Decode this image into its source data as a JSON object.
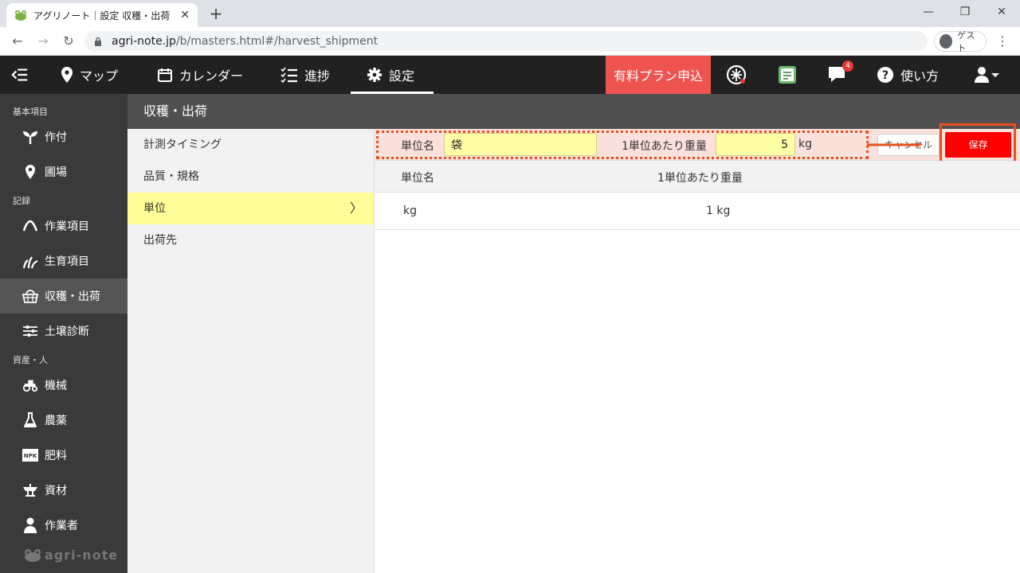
{
  "browser": {
    "tab_title": "アグリノート｜設定 収穫・出荷",
    "url_host": "agri-note.jp",
    "url_path": "/b/masters.html#/harvest_shipment",
    "profile_name": "ゲスト"
  },
  "header": {
    "nav": [
      {
        "label": "マップ",
        "icon": "map-pin-icon"
      },
      {
        "label": "カレンダー",
        "icon": "calendar-icon"
      },
      {
        "label": "進捗",
        "icon": "checklist-icon"
      },
      {
        "label": "設定",
        "icon": "gear-icon"
      }
    ],
    "active_nav": "設定",
    "paid_plan_label": "有料プラン申込",
    "notification_count": "4",
    "help_label": "使い方",
    "accent_color": "#ef5350"
  },
  "sidebar": {
    "sections": [
      {
        "label": "基本項目",
        "items": [
          "作付",
          "圃場"
        ]
      },
      {
        "label": "記録",
        "items": [
          "作業項目",
          "生育項目",
          "収穫・出荷",
          "土壌診断"
        ]
      },
      {
        "label": "資産・人",
        "items": [
          "機械",
          "農薬",
          "肥料",
          "資材",
          "作業者"
        ]
      }
    ],
    "active_item": "収穫・出荷",
    "npk_text": "NPK",
    "brand": "agri-note"
  },
  "content": {
    "title": "収穫・出荷",
    "subnav": [
      "計測タイミング",
      "品質・規格",
      "単位",
      "出荷先"
    ],
    "active_subnav": "単位",
    "form": {
      "unit_name_label": "単位名",
      "unit_name_value": "袋",
      "weight_label": "1単位あたり重量",
      "weight_value": "5",
      "weight_unit": "kg",
      "cancel_label": "キャンセル",
      "save_label": "保存"
    },
    "table": {
      "columns": [
        "単位名",
        "1単位あたり重量"
      ],
      "rows": [
        [
          "kg",
          "1 kg"
        ]
      ]
    }
  }
}
